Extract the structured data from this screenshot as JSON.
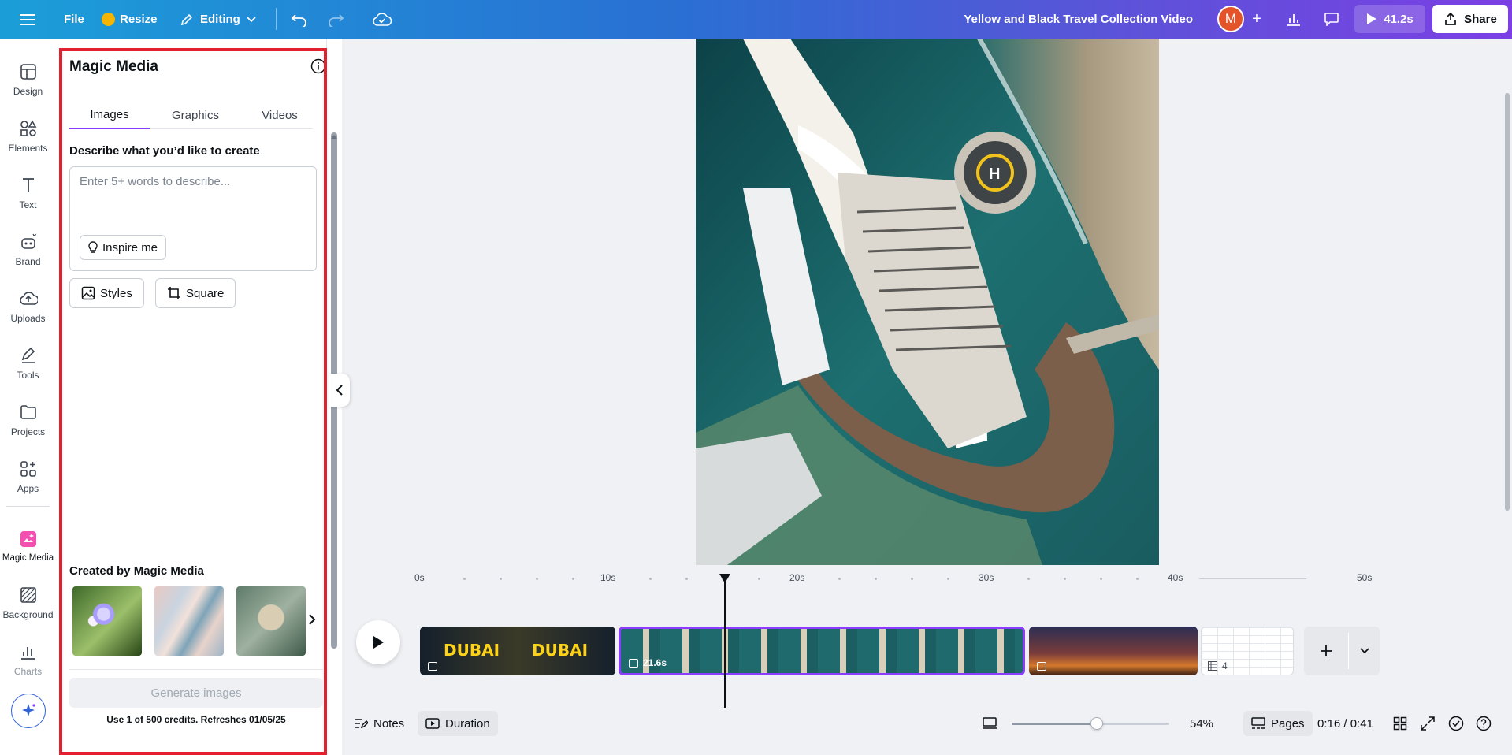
{
  "topbar": {
    "file_label": "File",
    "resize_label": "Resize",
    "editing_label": "Editing",
    "doc_title": "Yellow and Black Travel Collection Video",
    "avatar_initial": "M",
    "play_duration": "41.2s",
    "share_label": "Share"
  },
  "rail": {
    "items": [
      {
        "label": "Design",
        "icon": "layout-icon"
      },
      {
        "label": "Elements",
        "icon": "shapes-icon"
      },
      {
        "label": "Text",
        "icon": "text-icon"
      },
      {
        "label": "Brand",
        "icon": "brand-icon"
      },
      {
        "label": "Uploads",
        "icon": "cloud-upload-icon"
      },
      {
        "label": "Tools",
        "icon": "pen-icon"
      },
      {
        "label": "Projects",
        "icon": "folder-icon"
      },
      {
        "label": "Apps",
        "icon": "apps-icon"
      },
      {
        "label": "Magic Media",
        "icon": "magic-media-icon"
      },
      {
        "label": "Background",
        "icon": "background-icon"
      },
      {
        "label": "Charts",
        "icon": "charts-icon"
      }
    ]
  },
  "panel": {
    "title": "Magic Media",
    "tabs": [
      "Images",
      "Graphics",
      "Videos"
    ],
    "active_tab": "Images",
    "prompt_label": "Describe what you’d like to create",
    "prompt_placeholder": "Enter 5+ words to describe...",
    "prompt_value": "",
    "inspire_label": "Inspire me",
    "styles_label": "Styles",
    "aspect_label": "Square",
    "created_label": "Created by Magic Media",
    "generate_label": "Generate images",
    "credits_text": "Use 1 of 500 credits. Refreshes 01/05/25"
  },
  "timeline": {
    "ruler_labels": [
      "0s",
      "10s",
      "20s",
      "30s",
      "40s",
      "50s"
    ],
    "clip1_text": "DUBAI",
    "clip2_duration": "21.6s",
    "pages_count": "4"
  },
  "bottombar": {
    "notes_label": "Notes",
    "duration_label": "Duration",
    "zoom_percent": "54%",
    "zoom_level": 0.54,
    "pages_label": "Pages",
    "time_readout": "0:16 / 0:41"
  },
  "colors": {
    "accent": "#8b3dff",
    "highlight_frame": "#e5202e",
    "topbar_start": "#1b9ed8",
    "topbar_end": "#7b3fe4"
  }
}
